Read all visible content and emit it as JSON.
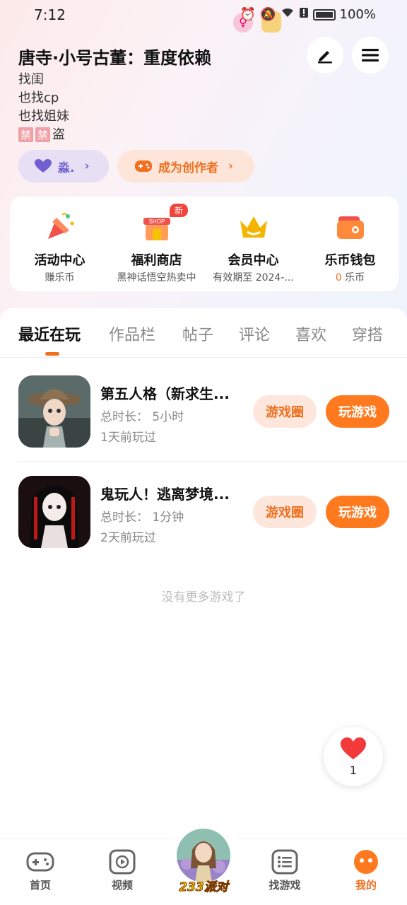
{
  "status_bar": {
    "time": "7:12",
    "battery": "100%"
  },
  "profile": {
    "name": "唐寺·小号古董：重度依赖",
    "bio": [
      "找闺",
      "也找cp",
      "也找姐妹"
    ],
    "bio_tag_1": "禁",
    "bio_tag_2": "禁",
    "bio_tail": "盗",
    "follow_label": "淼.",
    "creator_label": "成为创作者"
  },
  "quick": [
    {
      "label": "活动中心",
      "sub": "赚乐币",
      "icon": "party-popper-icon"
    },
    {
      "label": "福利商店",
      "sub": "黑神话悟空热卖中",
      "icon": "shop-icon",
      "badge": "新",
      "icon_text": "SHOP"
    },
    {
      "label": "会员中心",
      "sub": "有效期至 2024-...",
      "icon": "crown-icon"
    },
    {
      "label": "乐币钱包",
      "sub_value": "0",
      "sub_unit": " 乐币",
      "icon": "wallet-icon"
    }
  ],
  "tabs": [
    "最近在玩",
    "作品栏",
    "帖子",
    "评论",
    "喜欢",
    "穿搭"
  ],
  "games": [
    {
      "title": "第五人格（新求生...",
      "duration": "总时长：  5小时",
      "last_played": "1天前玩过",
      "circle_label": "游戏圈",
      "play_label": "玩游戏"
    },
    {
      "title": "鬼玩人！逃离梦境...",
      "duration": "总时长：  1分钟",
      "last_played": "2天前玩过",
      "circle_label": "游戏圈",
      "play_label": "玩游戏"
    }
  ],
  "no_more": "没有更多游戏了",
  "like_count": "1",
  "nav": {
    "home": "首页",
    "video": "视频",
    "center": "233派对",
    "find": "找游戏",
    "mine": "我的"
  },
  "colors": {
    "accent": "#ff7a1f",
    "purple": "#6f5fd0"
  }
}
